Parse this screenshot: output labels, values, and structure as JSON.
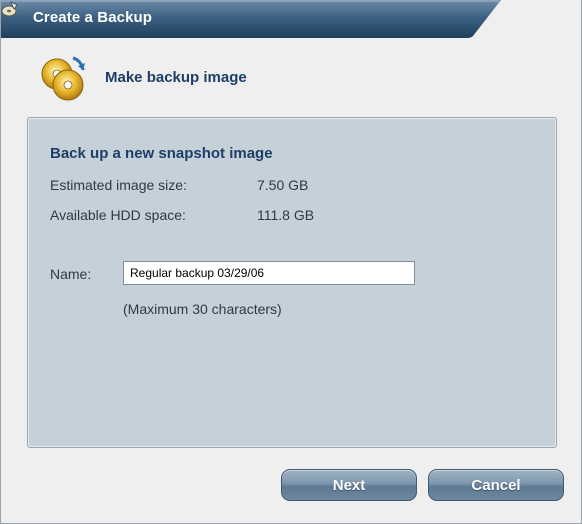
{
  "window": {
    "title": "Create a Backup"
  },
  "header": {
    "title": "Make backup image",
    "icon": "backup-discs-icon"
  },
  "panel": {
    "heading": "Back up a new snapshot image",
    "estimated_size_label": "Estimated image size:",
    "estimated_size_value": "7.50 GB",
    "available_space_label": "Available HDD space:",
    "available_space_value": "111.8 GB",
    "name_label": "Name:",
    "name_value": "Regular backup 03/29/06",
    "name_hint": "(Maximum 30 characters)"
  },
  "buttons": {
    "next_label": "Next",
    "cancel_label": "Cancel"
  },
  "colors": {
    "title_bar": "#2f5475",
    "panel_background": "#c6d0d9",
    "heading_text": "#1d3e66",
    "button": "#7e96ad"
  }
}
